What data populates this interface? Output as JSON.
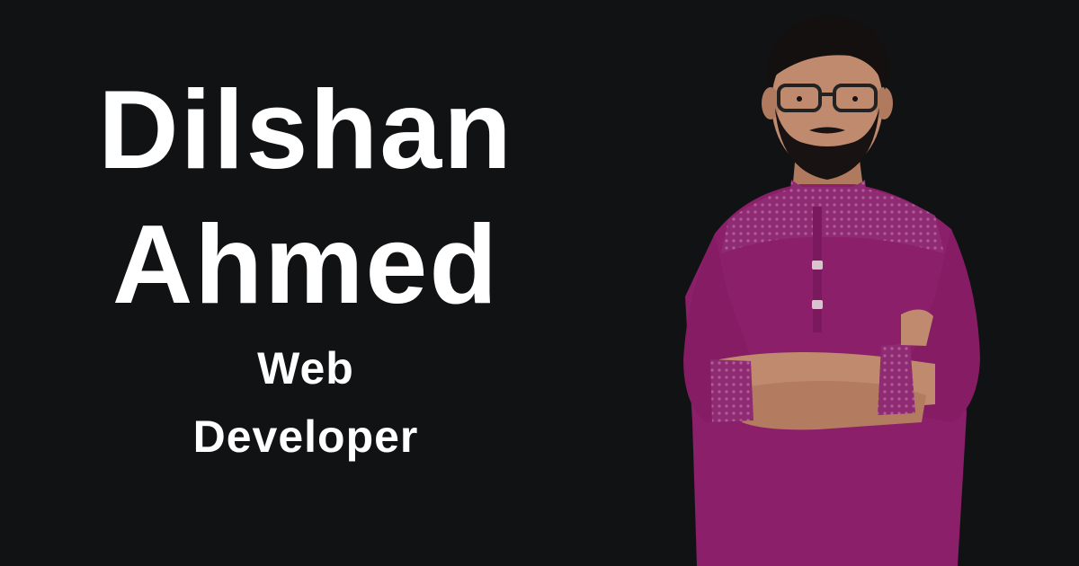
{
  "name": {
    "first": "Dilshan",
    "last": "Ahmed"
  },
  "role": {
    "line1": "Web",
    "line2": "Developer"
  },
  "colors": {
    "background": "#111214",
    "text": "#ffffff",
    "shirt": "#8b1f6a",
    "shirt_pattern": "#a14d8c",
    "skin": "#c08a6e",
    "hair": "#141010"
  },
  "photo": {
    "icon": "person-portrait-icon"
  }
}
